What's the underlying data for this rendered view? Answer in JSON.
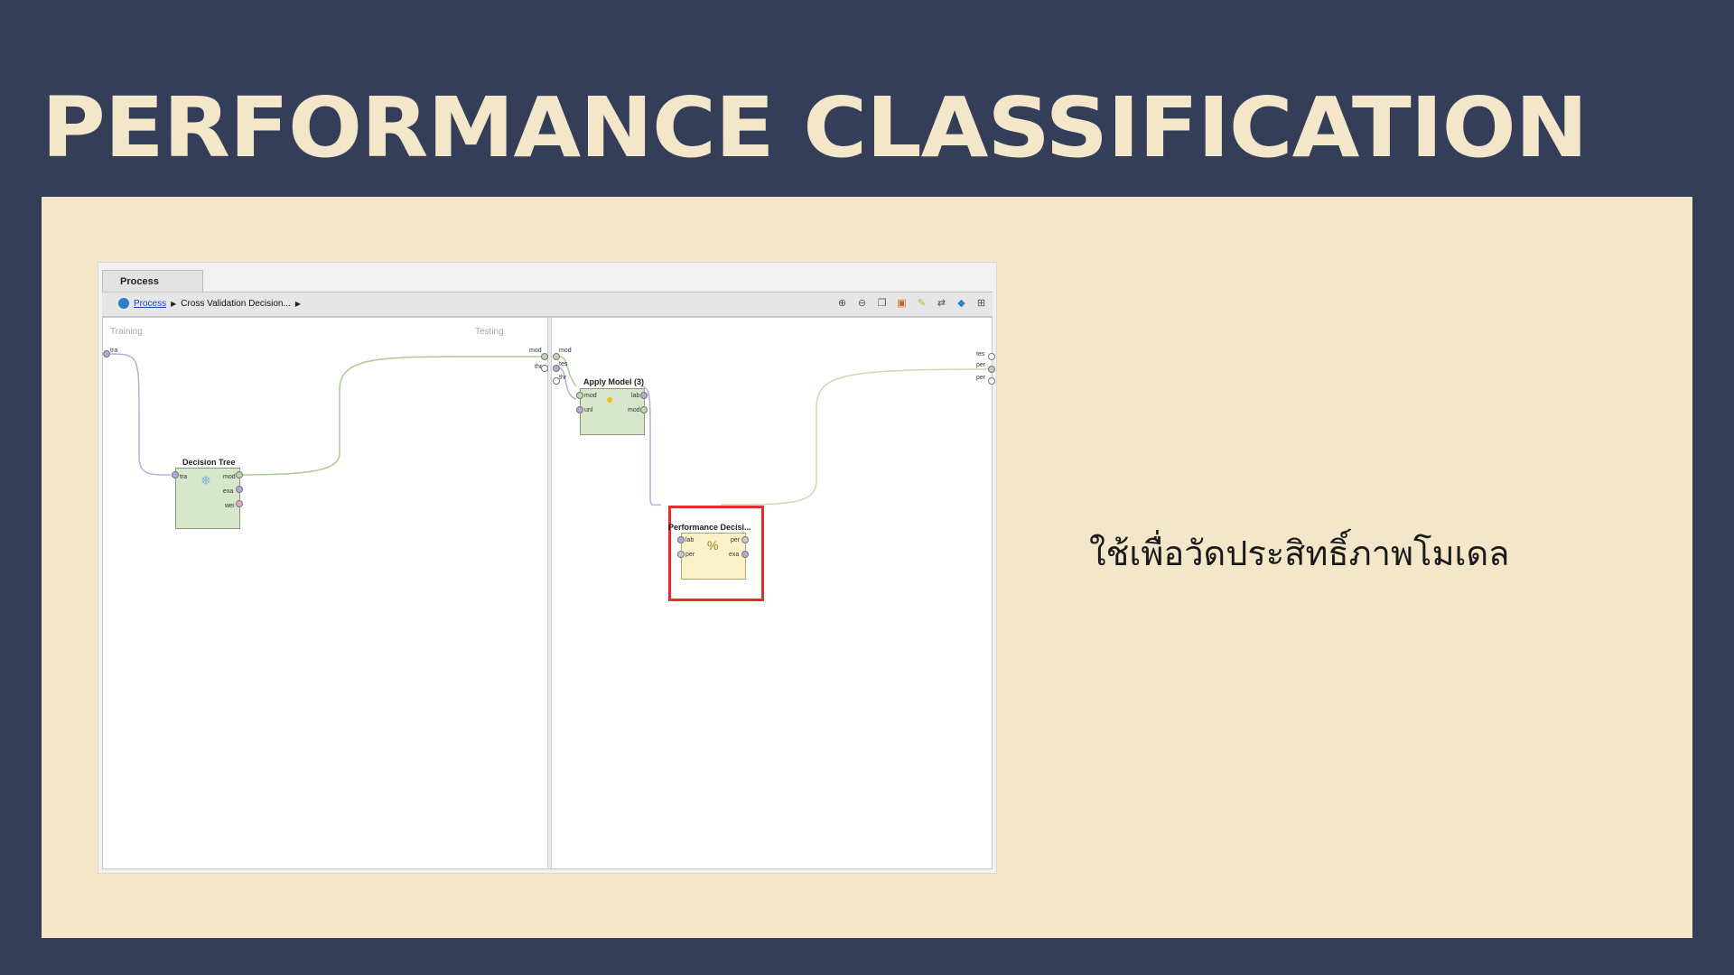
{
  "slide": {
    "title": "PERFORMANCE CLASSIFICATION",
    "caption": "ใช้เพื่อวัดประสิทธิ์ภาพโมเดล"
  },
  "process_panel": {
    "tab_label": "Process",
    "breadcrumb": {
      "root_link": "Process",
      "current": "Cross Validation Decision..."
    },
    "toolbar_icons": [
      "zoom-in-icon",
      "zoom-out-icon",
      "copy-icon",
      "paste-icon",
      "add-note-icon",
      "auto-wire-icon",
      "layout-icon",
      "fit-icon"
    ],
    "subprocess_training": {
      "label": "Training",
      "left_ports": [
        "tra"
      ],
      "right_ports": [
        "mod",
        "thr"
      ]
    },
    "subprocess_testing": {
      "label": "Testing",
      "left_ports": [
        "mod",
        "tes",
        "thr"
      ],
      "right_ports": [
        "tes",
        "per",
        "per"
      ]
    },
    "operators": {
      "decision_tree": {
        "title": "Decision Tree",
        "inputs": [
          "tra"
        ],
        "outputs": [
          "mod",
          "exa",
          "wei"
        ]
      },
      "apply_model": {
        "title": "Apply Model (3)",
        "inputs": [
          "mod",
          "unl"
        ],
        "outputs": [
          "lab",
          "mod"
        ]
      },
      "performance": {
        "title": "Performance Decisi...",
        "inputs": [
          "lab",
          "per"
        ],
        "outputs": [
          "per",
          "exa"
        ]
      }
    },
    "colors": {
      "highlight": "#e32c2c",
      "operator_green": "#d8e6cc",
      "operator_yellow": "#fbf1c8"
    }
  }
}
